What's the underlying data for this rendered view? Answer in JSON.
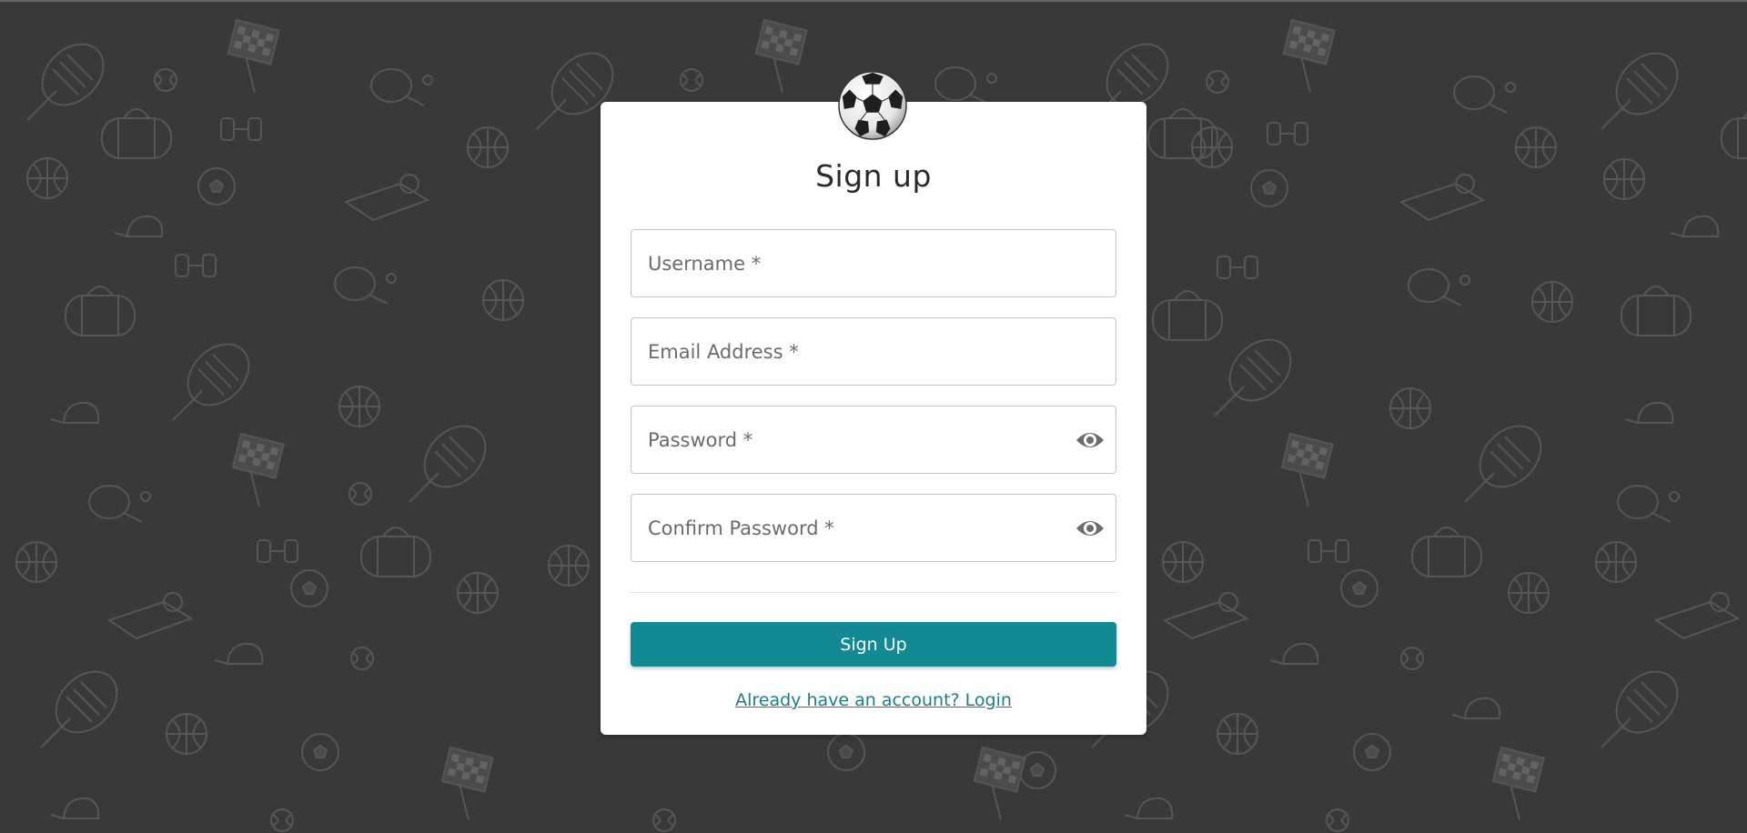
{
  "form": {
    "title": "Sign up",
    "username_placeholder": "Username *",
    "email_placeholder": "Email Address *",
    "password_placeholder": "Password *",
    "confirm_password_placeholder": "Confirm Password *",
    "submit_label": "Sign Up",
    "login_link": "Already have an account? Login"
  },
  "icons": {
    "logo": "soccer-ball-icon",
    "password_toggle": "eye-icon",
    "confirm_password_toggle": "eye-icon"
  },
  "colors": {
    "background": "#3a3839",
    "card": "#ffffff",
    "accent": "#128a93",
    "link": "#1a7f88"
  }
}
